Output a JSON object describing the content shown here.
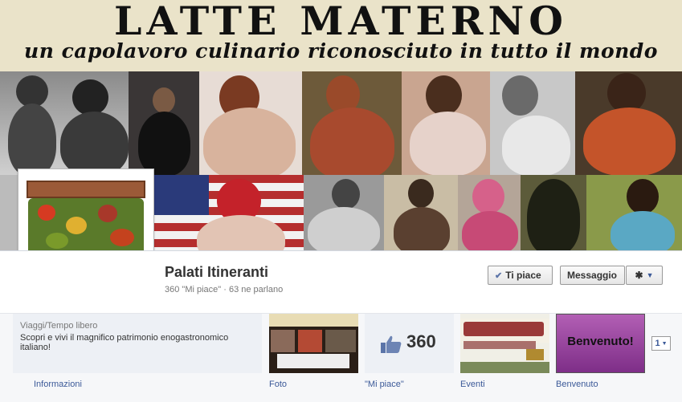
{
  "cover": {
    "banner_title": "LATTE MATERNO",
    "banner_subtitle": "un capolavoro culinario riconosciuto in tutto il mondo"
  },
  "page": {
    "name": "Palati Itineranti",
    "stats": "360 \"Mi piace\" · 63 ne parlano"
  },
  "actions": {
    "like_label": "Ti piace",
    "message_label": "Messaggio"
  },
  "about": {
    "category": "Viaggi/Tempo libero",
    "description": "Scopri e vivi il magnifico patrimonio enogastronomico italiano!"
  },
  "apps": [
    {
      "label": "Informazioni"
    },
    {
      "label": "Foto"
    },
    {
      "label": "\"Mi piace\"",
      "count": "360"
    },
    {
      "label": "Eventi"
    },
    {
      "label": "Benvenuto",
      "thumb_text": "Benvenuto!"
    }
  ],
  "more": {
    "label": "1"
  },
  "colors": {
    "link": "#3b5998",
    "banner_bg": "#eae3c9",
    "benvenuto_bg": "#9c46a0"
  }
}
